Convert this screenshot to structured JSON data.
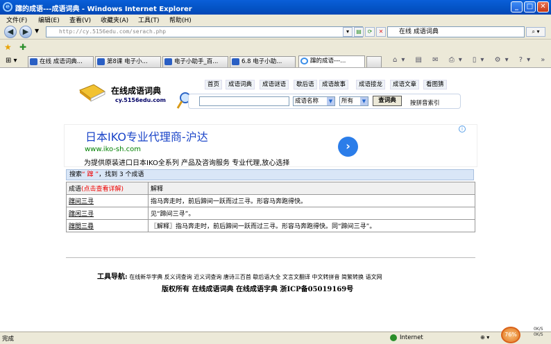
{
  "window": {
    "title": "蹿的成语---成语词典 - Windows Internet Explorer",
    "min_label": "_",
    "max_label": "□",
    "close_label": "✕"
  },
  "menu": [
    "文件(F)",
    "编辑(E)",
    "查看(V)",
    "收藏夹(A)",
    "工具(T)",
    "帮助(H)"
  ],
  "address": {
    "url": "http://cy.5156edu.com/serach.php"
  },
  "search": {
    "value": "在线 成语词典"
  },
  "tabs": [
    {
      "label": "在线 成语词典..."
    },
    {
      "label": "第8课 电子小..."
    },
    {
      "label": "电子小助手_百..."
    },
    {
      "label": "6.8 电子小助..."
    },
    {
      "label": "蹿的成语---..."
    }
  ],
  "site": {
    "name": "在线成语词典",
    "url": "cy.5156edu.com"
  },
  "topnav": [
    "首页",
    "成语词典",
    "成语谜语",
    "歇后语",
    "成语故事",
    "成语接龙",
    "成语文章",
    "看图猜"
  ],
  "search_form": {
    "type_select": "成语名称",
    "scope_select": "所有",
    "submit": "查词典",
    "pinyin_index": "按拼音索引"
  },
  "ad": {
    "title": "日本IKO专业代理商-沪达",
    "url": "www.iko-sh.com",
    "desc": "为提供原装进口日本IKO全系列 产品及咨询服务 专业代理,放心选择",
    "info": "i",
    "arrow": "›"
  },
  "result": {
    "prefix": "搜索",
    "keyword": "“ 蹿 ”",
    "suffix": "，找到 3 个成语"
  },
  "table": {
    "col1": "成语",
    "col1_hint": "(点击查看详解)",
    "col2": "解释",
    "rows": [
      {
        "idiom": "蹿间三寻",
        "explain": "指马奔走时，前后蹄间一跃而过三寻。形容马奔跑得快。"
      },
      {
        "idiom": "蹿闲三寻",
        "explain": "见“蹄间三寻”。"
      },
      {
        "idiom": "蹿間三尋",
        "explain": "〖解释〗指马奔走时，前后蹄间一跃而过三寻。形容马奔跑得快。同“蹄间三寻”。"
      }
    ]
  },
  "footer": {
    "tools_label": "工具导航:",
    "tools": "在线新华字典  反义词查询  近义词查询  唐诗三百首  歇后语大全  文言文翻译  中文转拼音  简繁转换  语文网",
    "copyright": "版权所有   在线成语词典  在线成语字典      浙ICP备05019169号"
  },
  "status": {
    "text": "完成",
    "zone": "Internet",
    "zoom": "76%",
    "speed_up": "0K/S",
    "speed_down": "0K/S"
  }
}
